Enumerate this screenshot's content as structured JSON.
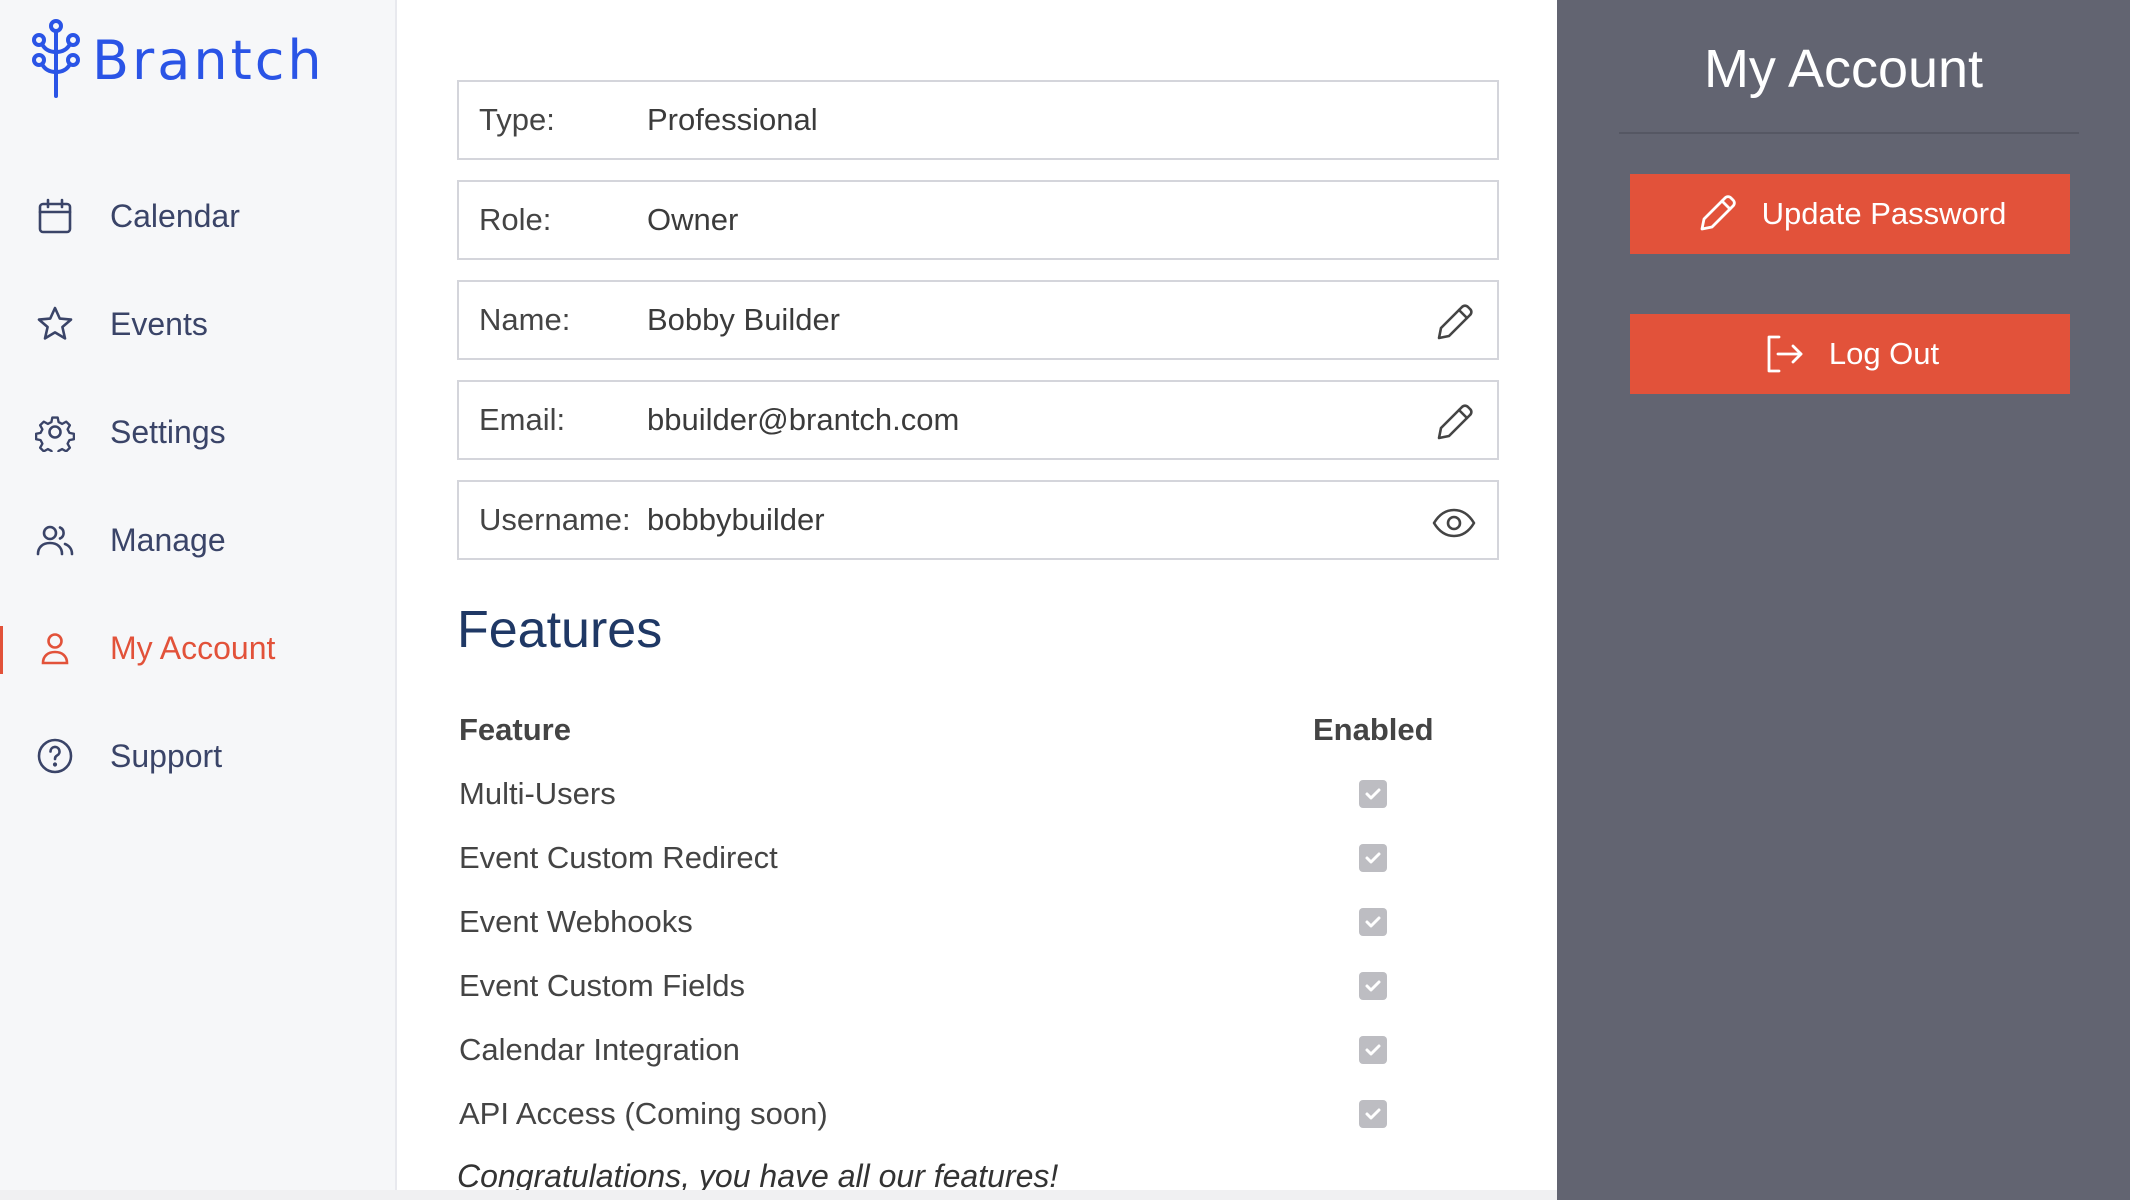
{
  "brand": {
    "name": "Brantch",
    "color": "#2a54e6"
  },
  "sidebar": {
    "items": [
      {
        "label": "Calendar",
        "icon": "calendar-icon"
      },
      {
        "label": "Events",
        "icon": "star-icon"
      },
      {
        "label": "Settings",
        "icon": "gear-icon"
      },
      {
        "label": "Manage",
        "icon": "users-icon"
      },
      {
        "label": "My Account",
        "icon": "user-icon",
        "active": true
      },
      {
        "label": "Support",
        "icon": "help-circle-icon"
      }
    ]
  },
  "account": {
    "fields": [
      {
        "label": "Type:",
        "value": "Professional",
        "action": null
      },
      {
        "label": "Role:",
        "value": "Owner",
        "action": null
      },
      {
        "label": "Name:",
        "value": "Bobby Builder",
        "action": "pencil-icon"
      },
      {
        "label": "Email:",
        "value": "bbuilder@brantch.com",
        "action": "pencil-icon"
      },
      {
        "label": "Username:",
        "value": "bobbybuilder",
        "action": "eye-icon"
      }
    ]
  },
  "features": {
    "title": "Features",
    "header_feature": "Feature",
    "header_enabled": "Enabled",
    "rows": [
      {
        "name": "Multi-Users",
        "enabled": true
      },
      {
        "name": "Event Custom Redirect",
        "enabled": true
      },
      {
        "name": "Event Webhooks",
        "enabled": true
      },
      {
        "name": "Event Custom Fields",
        "enabled": true
      },
      {
        "name": "Calendar Integration",
        "enabled": true
      },
      {
        "name": "API Access (Coming soon)",
        "enabled": true
      }
    ],
    "message": "Congratulations, you have all our features!"
  },
  "panel": {
    "title": "My Account",
    "update_password_label": "Update Password",
    "logout_label": "Log Out"
  },
  "colors": {
    "accent": "#e2523a",
    "panel_bg": "#626471",
    "nav_text": "#3a4468",
    "heading": "#1f3865"
  }
}
